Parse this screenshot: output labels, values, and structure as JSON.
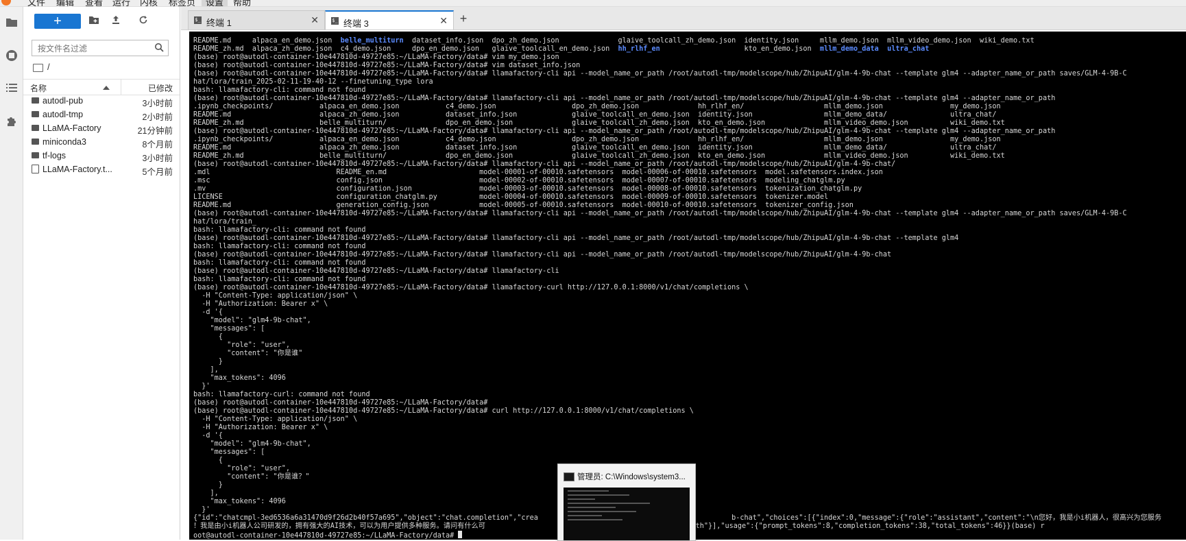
{
  "menubar": {
    "items": [
      "文件",
      "编辑",
      "查看",
      "运行",
      "内核",
      "标签页",
      "设置",
      "帮助"
    ]
  },
  "filebrowser": {
    "new_label": "+",
    "filter_placeholder": "按文件名过滤",
    "path": "/",
    "col_name": "名称",
    "col_modified": "已修改",
    "files": [
      {
        "name": "autodl-pub",
        "type": "folder",
        "modified": "3小时前"
      },
      {
        "name": "autodl-tmp",
        "type": "folder",
        "modified": "2小时前"
      },
      {
        "name": "LLaMA-Factory",
        "type": "folder",
        "modified": "21分钟前"
      },
      {
        "name": "miniconda3",
        "type": "folder",
        "modified": "8个月前"
      },
      {
        "name": "tf-logs",
        "type": "folder",
        "modified": "3小时前"
      },
      {
        "name": "LLaMA-Factory.t...",
        "type": "file",
        "modified": "5个月前"
      }
    ]
  },
  "tabs": [
    {
      "label": "终端 1",
      "active": false
    },
    {
      "label": "终端 3",
      "active": true
    }
  ],
  "cmd_popup": {
    "title": "管理员: C:\\Windows\\system3..."
  },
  "terminal": {
    "segments": [
      [
        "README.md     alpaca_en_demo.json  ",
        ""
      ],
      [
        "belle_multiturn",
        "dir"
      ],
      [
        "  dataset_info.json  dpo_zh_demo.json              glaive_toolcall_zh_demo.json  identity.json     mllm_demo.json  mllm_video_demo.json  wiki_demo.txt\nREADME_zh.md  alpaca_zh_demo.json  c4_demo.json     dpo_en_demo.json   glaive_toolcall_en_demo.json  ",
        ""
      ],
      [
        "hh_rlhf_en",
        "dir"
      ],
      [
        "                    kto_en_demo.json  ",
        ""
      ],
      [
        "mllm_demo_data",
        "dir"
      ],
      [
        "  ",
        ""
      ],
      [
        "ultra_chat",
        "dir"
      ],
      [
        "\n(base) root@autodl-container-10e447810d-49727e85:~/LLaMA-Factory/data# vim my_demo.json\n(base) root@autodl-container-10e447810d-49727e85:~/LLaMA-Factory/data# vim dataset_info.json\n(base) root@autodl-container-10e447810d-49727e85:~/LLaMA-Factory/data# llamafactory-cli api --model_name_or_path /root/autodl-tmp/modelscope/hub/ZhipuAI/glm-4-9b-chat --template glm4 --adapter_name_or_path saves/GLM-4-9B-C\nhat/lora/train_2025-02-11-19-40-12 --finetuning_type lora\nbash: llamafactory-cli: command not found\n(base) root@autodl-container-10e447810d-49727e85:~/LLaMA-Factory/data# llamafactory-cli api --model_name_or_path /root/autodl-tmp/modelscope/hub/ZhipuAI/glm-4-9b-chat --template glm4 --adapter_name_or_path\n.ipynb_checkpoints/           alpaca_en_demo.json           c4_demo.json                  dpo_zh_demo.json              hh_rlhf_en/                   mllm_demo.json                my_demo.json\nREADME.md                     alpaca_zh_demo.json           dataset_info.json             glaive_toolcall_en_demo.json  identity.json                 mllm_demo_data/               ultra_chat/\nREADME_zh.md                  belle_multiturn/              dpo_en_demo.json              glaive_toolcall_zh_demo.json  kto_en_demo.json              mllm_video_demo.json          wiki_demo.txt\n(base) root@autodl-container-10e447810d-49727e85:~/LLaMA-Factory/data# llamafactory-cli api --model_name_or_path /root/autodl-tmp/modelscope/hub/ZhipuAI/glm-4-9b-chat --template glm4 --adapter_name_or_path\n.ipynb_checkpoints/           alpaca_en_demo.json           c4_demo.json                  dpo_zh_demo.json              hh_rlhf_en/                   mllm_demo.json                my_demo.json\nREADME.md                     alpaca_zh_demo.json           dataset_info.json             glaive_toolcall_en_demo.json  identity.json                 mllm_demo_data/               ultra_chat/\nREADME_zh.md                  belle_multiturn/              dpo_en_demo.json              glaive_toolcall_zh_demo.json  kto_en_demo.json              mllm_video_demo.json          wiki_demo.txt\n(base) root@autodl-container-10e447810d-49727e85:~/LLaMA-Factory/data# llamafactory-cli api --model_name_or_path /root/autodl-tmp/modelscope/hub/ZhipuAI/glm-4-9b-chat/\n.mdl                              README_en.md                      model-00001-of-00010.safetensors  model-00006-of-00010.safetensors  model.safetensors.index.json\n.msc                              config.json                       model-00002-of-00010.safetensors  model-00007-of-00010.safetensors  modeling_chatglm.py\n.mv                               configuration.json                model-00003-of-00010.safetensors  model-00008-of-00010.safetensors  tokenization_chatglm.py\nLICENSE                           configuration_chatglm.py          model-00004-of-00010.safetensors  model-00009-of-00010.safetensors  tokenizer.model\nREADME.md                         generation_config.json            model-00005-of-00010.safetensors  model-00010-of-00010.safetensors  tokenizer_config.json\n(base) root@autodl-container-10e447810d-49727e85:~/LLaMA-Factory/data# llamafactory-cli api --model_name_or_path /root/autodl-tmp/modelscope/hub/ZhipuAI/glm-4-9b-chat --template glm4 --adapter_name_or_path saves/GLM-4-9B-C\nhat/lora/train_\nbash: llamafactory-cli: command not found\n(base) root@autodl-container-10e447810d-49727e85:~/LLaMA-Factory/data# llamafactory-cli api --model_name_or_path /root/autodl-tmp/modelscope/hub/ZhipuAI/glm-4-9b-chat --template glm4\nbash: llamafactory-cli: command not found\n(base) root@autodl-container-10e447810d-49727e85:~/LLaMA-Factory/data# llamafactory-cli api --model_name_or_path /root/autodl-tmp/modelscope/hub/ZhipuAI/glm-4-9b-chat\nbash: llamafactory-cli: command not found\n(base) root@autodl-container-10e447810d-49727e85:~/LLaMA-Factory/data# llamafactory-cli\nbash: llamafactory-cli: command not found\n(base) root@autodl-container-10e447810d-49727e85:~/LLaMA-Factory/data# llamafactory-curl http://127.0.0.1:8000/v1/chat/completions \\\n  -H \"Content-Type: application/json\" \\\n  -H \"Authorization: Bearer x\" \\\n  -d '{\n    \"model\": \"glm4-9b-chat\",\n    \"messages\": [\n      {\n        \"role\": \"user\",\n        \"content\": \"你是谁\"\n      }\n    ],\n    \"max_tokens\": 4096\n  }'\nbash: llamafactory-curl: command not found\n(base) root@autodl-container-10e447810d-49727e85:~/LLaMA-Factory/data#\n(base) root@autodl-container-10e447810d-49727e85:~/LLaMA-Factory/data# curl http://127.0.0.1:8000/v1/chat/completions \\\n  -H \"Content-Type: application/json\" \\\n  -H \"Authorization: Bearer x\" \\\n  -d '{\n    \"model\": \"glm4-9b-chat\",\n    \"messages\": [\n      {\n        \"role\": \"user\",\n        \"content\": \"你是谁？\"\n      }\n    ],\n    \"max_tokens\": 4096\n  }'\n{\"id\":\"chatcmpl-3ed6536a6a31470d9f26d2b40f57a695\",\"object\":\"chat.completion\",\"crea                                              b-chat\",\"choices\":[{\"index\":0,\"message\":{\"role\":\"assistant\",\"content\":\"\\n您好，我是小i机器人，很高兴为您服务\n！我是由小i机器人公司研发的，拥有强大的AI技术，可以为用户提供多种服务。请问有什么可                        ull},\"finish_reason\":\"length\"}],\"usage\":{\"prompt_tokens\":8,\"completion_tokens\":38,\"total_tokens\":46}}(base) r\noot@autodl-container-10e447810d-49727e85:~/LLaMA-Factory/data# ",
        ""
      ]
    ]
  }
}
